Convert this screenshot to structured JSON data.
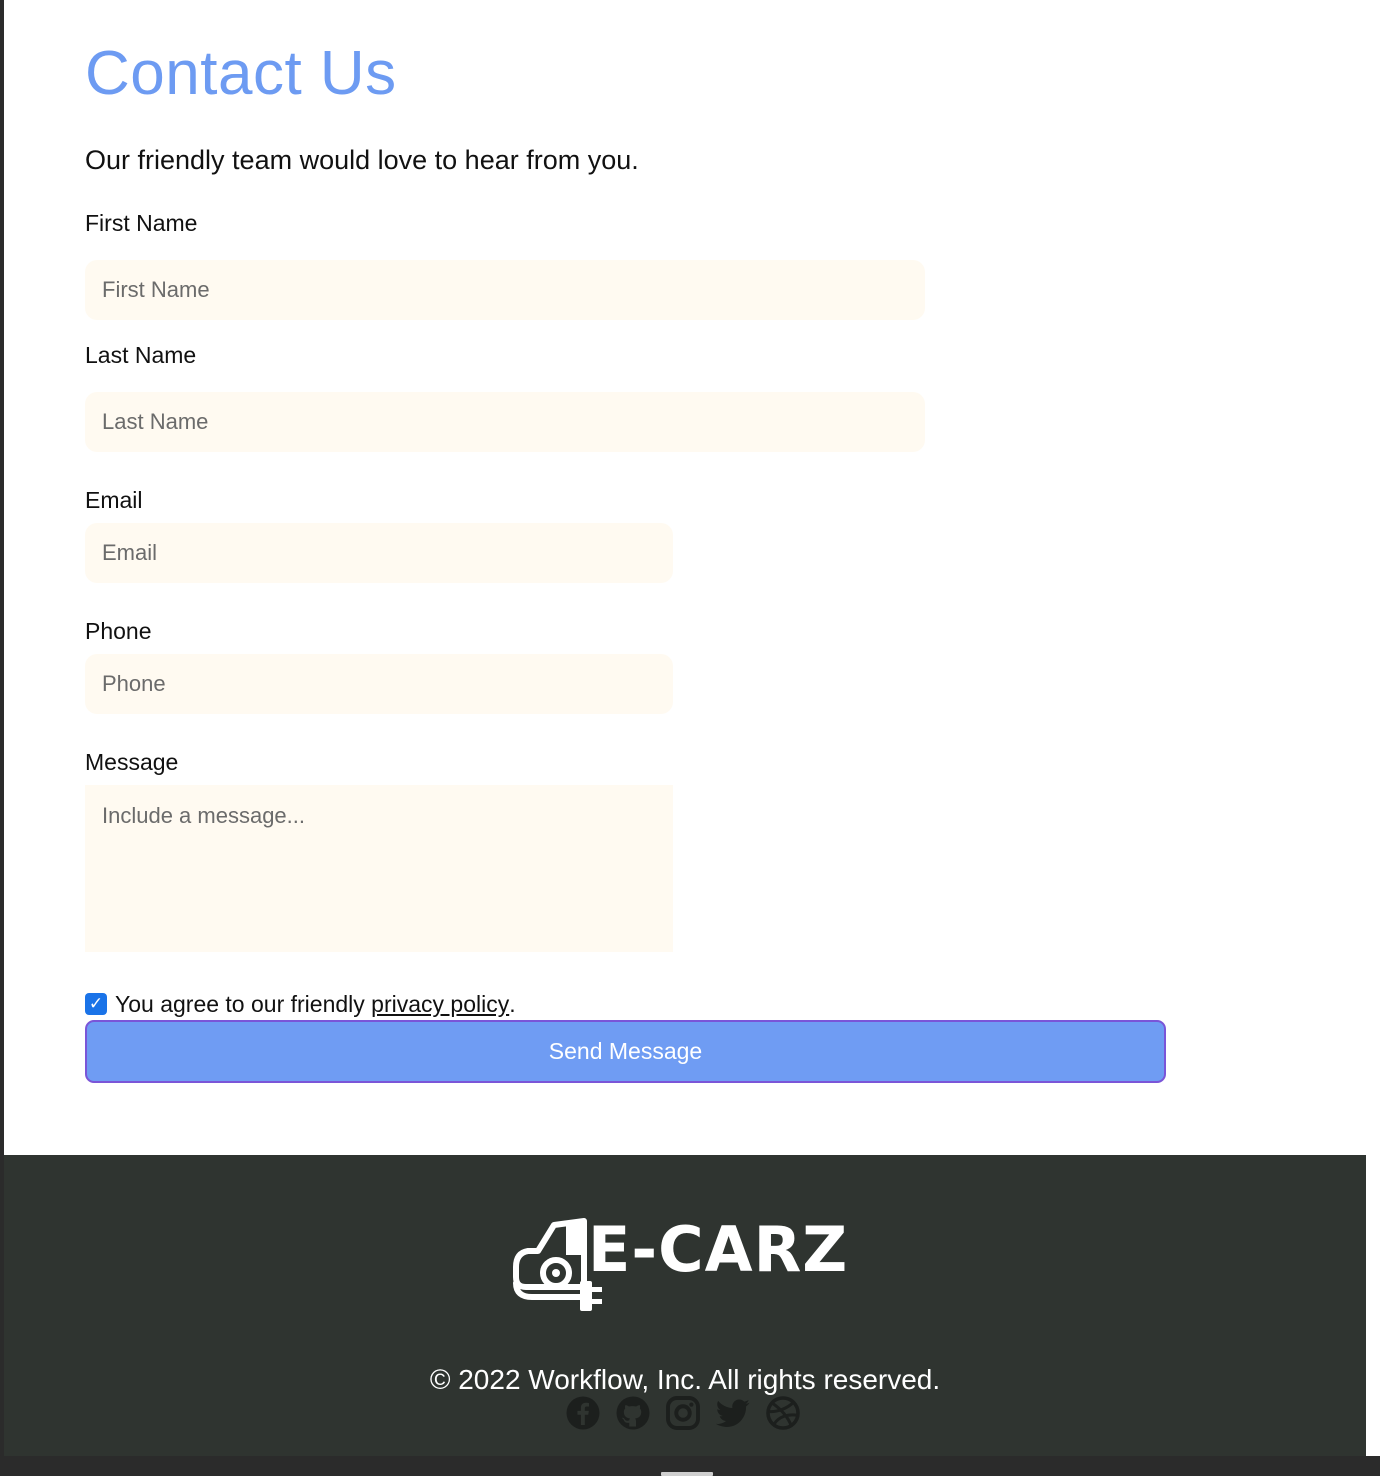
{
  "page": {
    "title": "Contact Us",
    "subtitle": "Our friendly team would love to hear from you."
  },
  "form": {
    "first_name": {
      "label": "First Name",
      "placeholder": "First Name",
      "value": ""
    },
    "last_name": {
      "label": "Last Name",
      "placeholder": "Last Name",
      "value": ""
    },
    "email": {
      "label": "Email",
      "placeholder": "Email",
      "value": ""
    },
    "phone": {
      "label": "Phone",
      "placeholder": "Phone",
      "value": ""
    },
    "message": {
      "label": "Message",
      "placeholder": "Include a message...",
      "value": ""
    },
    "agree": {
      "checked": true,
      "text_before": "You agree to our friendly ",
      "link_text": "privacy policy",
      "text_after": "."
    },
    "submit_label": "Send Message"
  },
  "footer": {
    "logo_text": "E-CARZ",
    "copyright": "© 2022 Workflow, Inc. All rights reserved.",
    "social_icons": [
      "facebook-icon",
      "github-icon",
      "instagram-icon",
      "twitter-icon",
      "dribbble-icon"
    ]
  },
  "colors": {
    "accent": "#6d9bf2",
    "button": "#6f9cf3",
    "button_border": "#7a55d8",
    "input_bg": "#fffaf1",
    "footer_bg": "#2f3430",
    "checkbox": "#1a73e8"
  }
}
